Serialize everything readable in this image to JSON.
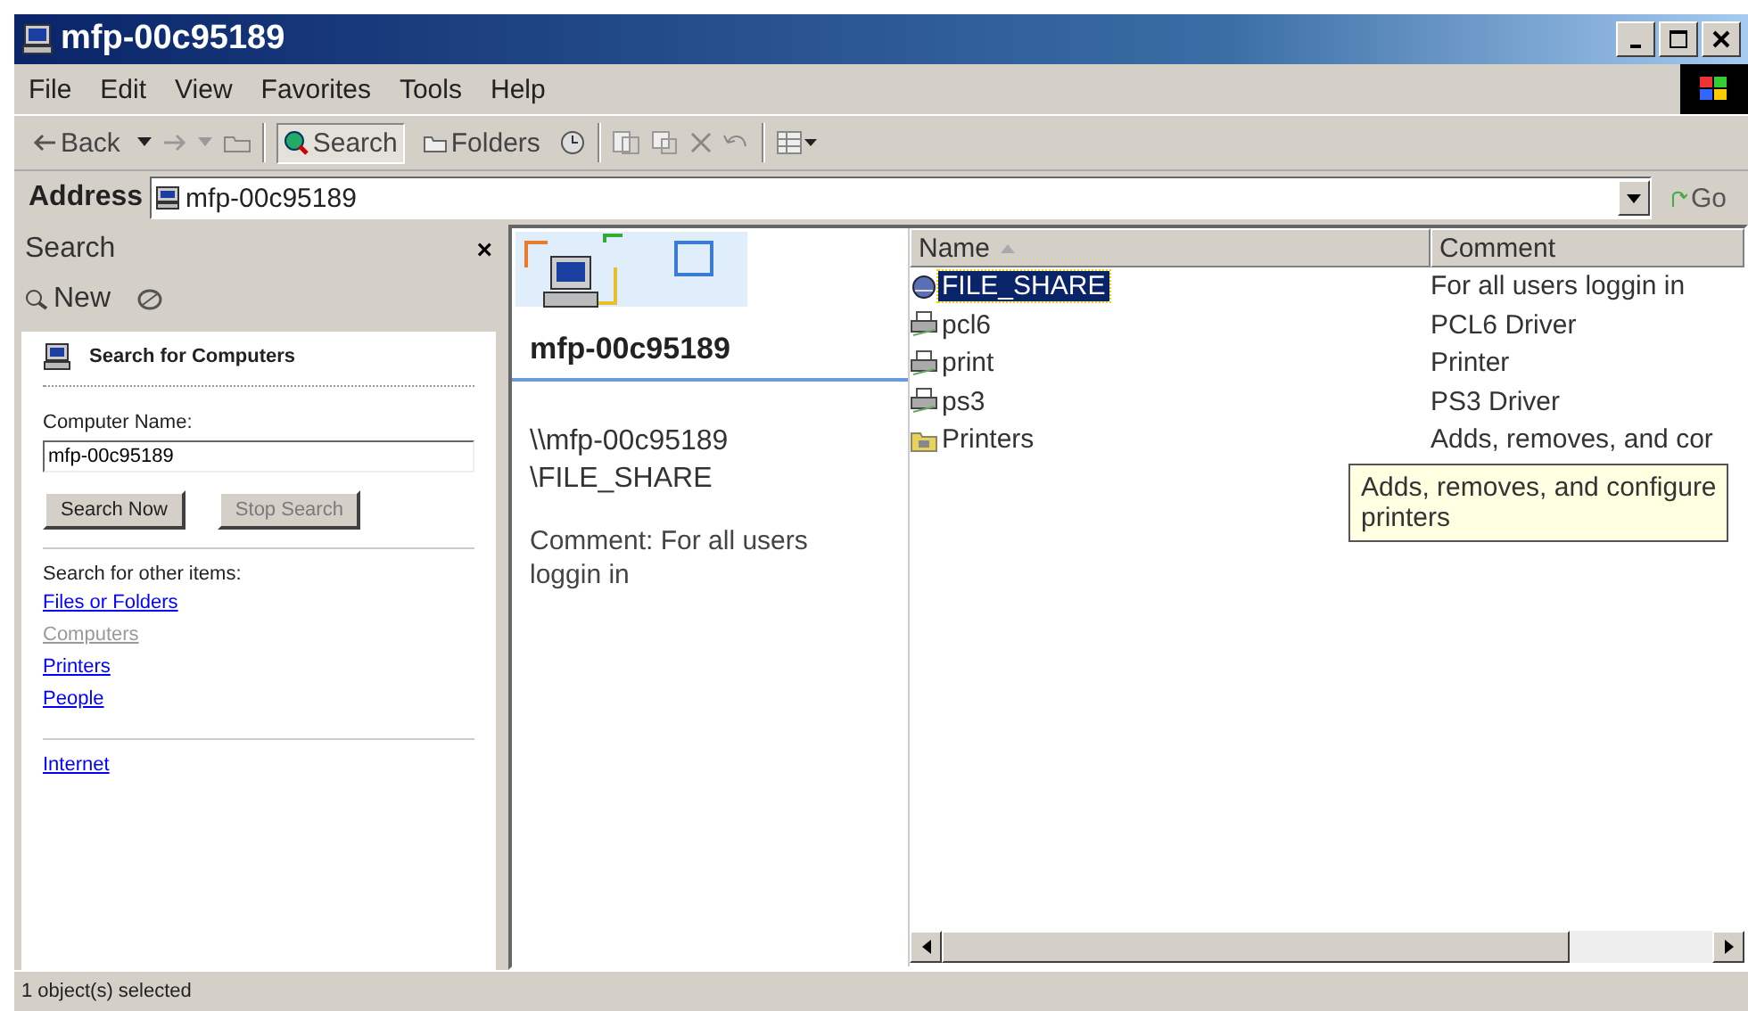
{
  "window": {
    "title": "mfp-00c95189"
  },
  "menu": [
    "File",
    "Edit",
    "View",
    "Favorites",
    "Tools",
    "Help"
  ],
  "toolbar": [
    {
      "kind": "back",
      "label": "Back"
    },
    {
      "kind": "search",
      "label": "Search"
    },
    {
      "kind": "folders",
      "label": "Folders"
    }
  ],
  "address": {
    "label": "Address",
    "value": "mfp-00c95189",
    "go": "Go"
  },
  "search_pane": {
    "title": "Search",
    "close": "×",
    "new": "New",
    "heading": "Search for Computers",
    "field_label": "Computer Name:",
    "field_value": "mfp-00c95189",
    "search_button": "Search Now",
    "stop_button": {
      "label": "Stop Search",
      "disabled": true
    },
    "other_label": "Search for other items:",
    "links": [
      {
        "label": "Files or Folders",
        "disabled": false
      },
      {
        "label": "Computers",
        "disabled": true
      },
      {
        "label": "Printers",
        "disabled": false
      },
      {
        "label": "People",
        "disabled": false
      }
    ],
    "internet": "Internet"
  },
  "details": {
    "title": "mfp-00c95189",
    "path_line1": "\\\\mfp-00c95189",
    "path_line2": "\\FILE_SHARE",
    "comment": "Comment: For all users loggin in"
  },
  "table": {
    "columns": [
      "Name",
      "Comment"
    ],
    "rows": [
      {
        "kind": "share",
        "name": "FILE_SHARE",
        "comment": "For all users loggin in",
        "selected": true
      },
      {
        "kind": "printer",
        "name": "pcl6",
        "comment": "PCL6 Driver",
        "selected": false
      },
      {
        "kind": "printer",
        "name": "print",
        "comment": "Printer",
        "selected": false
      },
      {
        "kind": "printer",
        "name": "ps3",
        "comment": "PS3 Driver",
        "selected": false
      },
      {
        "kind": "folder",
        "name": "Printers",
        "comment": "Adds, removes, and cor",
        "selected": false
      }
    ]
  },
  "tooltip": {
    "line1": "Adds, removes, and configure",
    "line2": "printers"
  },
  "status_bar": "1 object(s) selected"
}
